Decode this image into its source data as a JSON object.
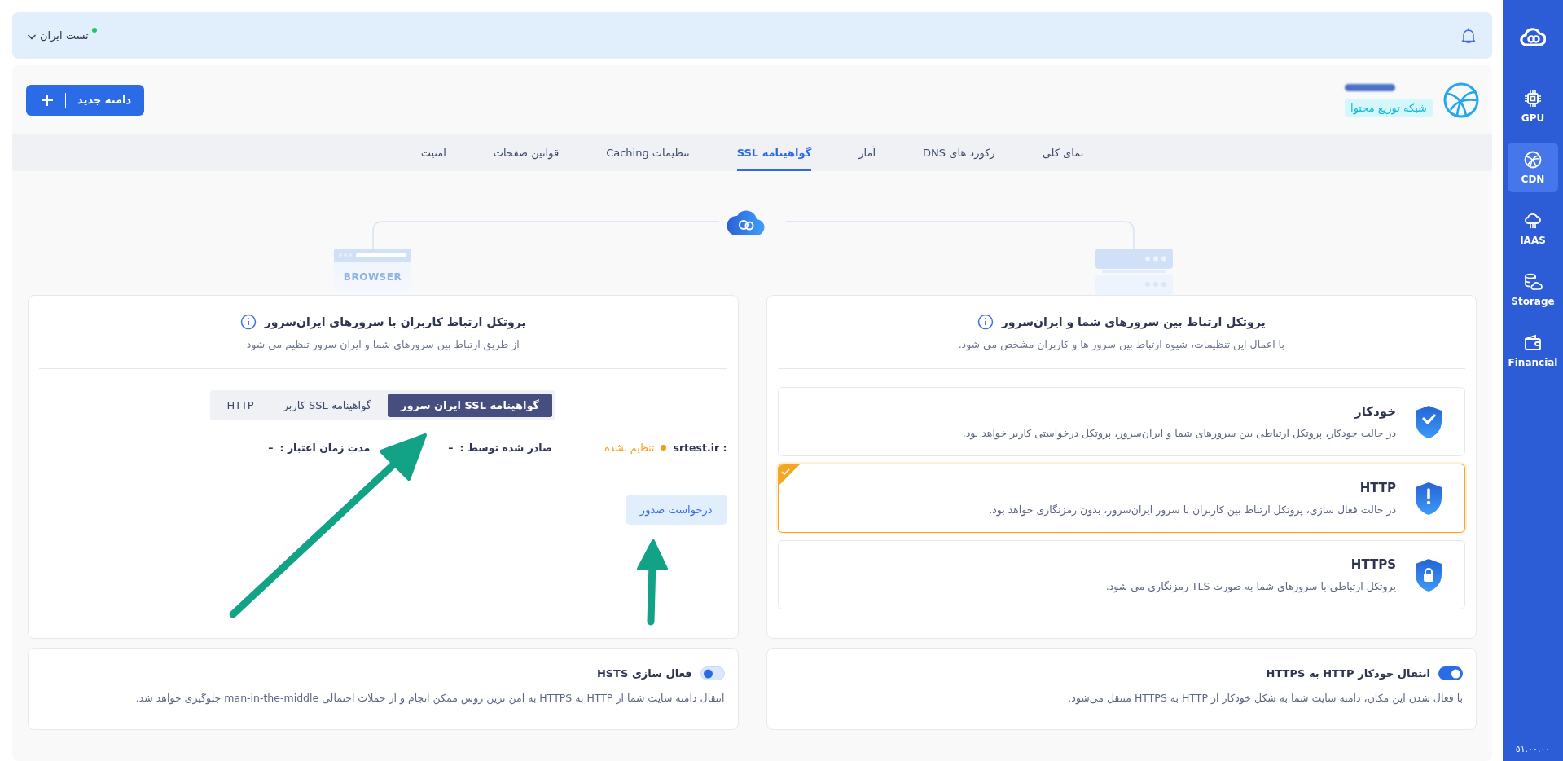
{
  "sidebar": {
    "items": [
      {
        "label": "GPU",
        "kind": "chip",
        "selected": false
      },
      {
        "label": "CDN",
        "kind": "globe",
        "selected": true
      },
      {
        "label": "IAAS",
        "kind": "cloud",
        "selected": false
      },
      {
        "label": "Storage",
        "kind": "database",
        "selected": false
      },
      {
        "label": "Financial",
        "kind": "wallet",
        "selected": false
      }
    ],
    "version": "٥١.٠٠.٠٠"
  },
  "top_bar": {
    "account": "تست ایران",
    "online": true
  },
  "header": {
    "category": "شبکه توزیع محتوا",
    "new_domain_button": "دامنه جدید"
  },
  "tabs": [
    {
      "label": "نمای کلی",
      "selected": false
    },
    {
      "label": "رکورد های DNS",
      "selected": false
    },
    {
      "label": "آمار",
      "selected": false
    },
    {
      "label": "گواهینامه SSL",
      "selected": true
    },
    {
      "label": "تنظیمات Caching",
      "selected": false
    },
    {
      "label": "قوانین صفحات",
      "selected": false
    },
    {
      "label": "امنیت",
      "selected": false
    }
  ],
  "diagram": {
    "browser_label": "BROWSER"
  },
  "server_protocol": {
    "title": "پروتکل ارتباط بین سرورهای شما و ایران‌سرور",
    "subtitle": "با اعمال این تنظیمات، شیوه ارتباط بین سرور ها و کاربران مشخص می شود.",
    "options": [
      {
        "kind": "check",
        "title": "خودکار",
        "description": "در حالت خودکار، پروتکل ارتباطی بین سرورهای شما و ایران‌سرور، پروتکل درخواستی کاربر خواهد بود.",
        "selected": false
      },
      {
        "kind": "alert",
        "title": "HTTP",
        "description": "در حالت فعال سازی، پروتکل ارتباط بین کاربران با سرور ایران‌سرور، بدون رمزنگاری خواهد بود.",
        "selected": true
      },
      {
        "kind": "lock",
        "title": "HTTPS",
        "description": "پروتکل ارتباطی با سرورهای شما به صورت TLS رمزنگاری می شود.",
        "selected": false
      }
    ]
  },
  "user_protocol": {
    "title": "پروتکل ارتباط کاربران با سرورهای ایران‌سرور",
    "subtitle": "از طریق ارتباط بین سرورهای شما و ایران سرور تنظیم می شود",
    "cert_tabs": [
      {
        "label": "گواهینامه SSL ایران سرور",
        "selected": true
      },
      {
        "label": "گواهینامه SSL کاربر",
        "selected": false
      },
      {
        "label": "HTTP",
        "selected": false
      }
    ],
    "status": {
      "domain": "srtest.ir :",
      "state": "تنظیم نشده",
      "configured": false,
      "issuer_label": "صادر شده توسط :",
      "issuer": "–",
      "validity_label": "مدت زمان اعتبار :",
      "validity": "–"
    },
    "action_button": "درخواست صدور"
  },
  "https_redirect": {
    "label": "انتقال خودکار HTTP به HTTPS",
    "on": true,
    "description": "با فعال شدن این مکان، دامنه سایت شما به شکل خودکار از HTTP به HTTPS منتقل می‌شود."
  },
  "hsts": {
    "label": "فعال سازی HSTS",
    "on": false,
    "description": "انتقال دامنه سایت شما از HTTP به HTTPS به امن ترین روش ممکن انجام و از حملات احتمالی man-in-the-middle جلوگیری خواهد شد."
  }
}
